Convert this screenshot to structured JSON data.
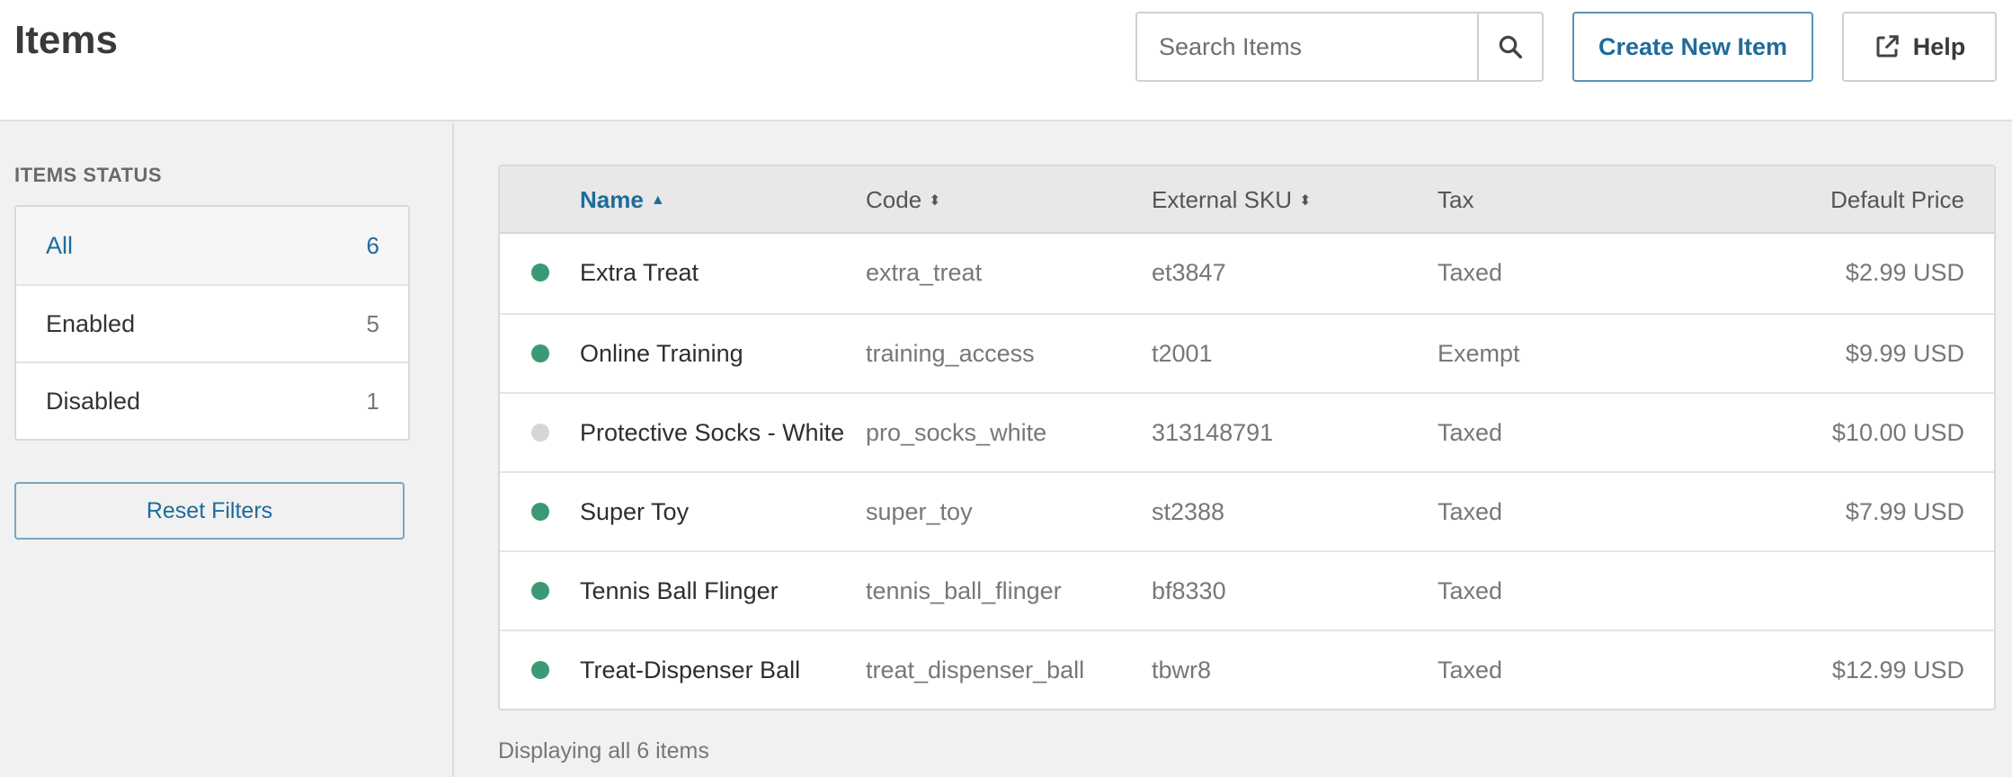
{
  "header": {
    "title": "Items",
    "search_placeholder": "Search Items",
    "create_label": "Create New Item",
    "help_label": "Help"
  },
  "sidebar": {
    "heading": "ITEMS STATUS",
    "items": [
      {
        "label": "All",
        "count": "6"
      },
      {
        "label": "Enabled",
        "count": "5"
      },
      {
        "label": "Disabled",
        "count": "1"
      }
    ],
    "reset_label": "Reset Filters"
  },
  "table": {
    "columns": {
      "name": "Name",
      "code": "Code",
      "sku": "External SKU",
      "tax": "Tax",
      "price": "Default Price"
    },
    "rows": [
      {
        "status": "enabled",
        "name": "Extra Treat",
        "code": "extra_treat",
        "sku": "et3847",
        "tax": "Taxed",
        "price": "$2.99 USD"
      },
      {
        "status": "enabled",
        "name": "Online Training",
        "code": "training_access",
        "sku": "t2001",
        "tax": "Exempt",
        "price": "$9.99 USD"
      },
      {
        "status": "disabled",
        "name": "Protective Socks - White",
        "code": "pro_socks_white",
        "sku": "313148791",
        "tax": "Taxed",
        "price": "$10.00 USD"
      },
      {
        "status": "enabled",
        "name": "Super Toy",
        "code": "super_toy",
        "sku": "st2388",
        "tax": "Taxed",
        "price": "$7.99 USD"
      },
      {
        "status": "enabled",
        "name": "Tennis Ball Flinger",
        "code": "tennis_ball_flinger",
        "sku": "bf8330",
        "tax": "Taxed",
        "price": ""
      },
      {
        "status": "enabled",
        "name": "Treat-Dispenser Ball",
        "code": "treat_dispenser_ball",
        "sku": "tbwr8",
        "tax": "Taxed",
        "price": "$12.99 USD"
      }
    ]
  },
  "footer": {
    "text": "Displaying all 6 items"
  },
  "colors": {
    "enabled": "#3a9a74",
    "disabled": "#d6d6d6",
    "accent": "#1f6b9a"
  },
  "icons": {
    "search": "search-icon",
    "help": "external-link-icon",
    "sort_asc": "caret-up-icon",
    "sort_both": "sort-icon"
  }
}
